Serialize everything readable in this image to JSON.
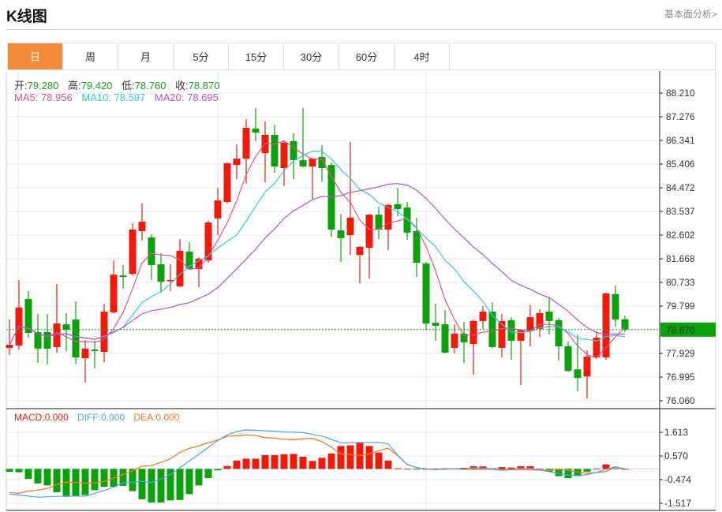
{
  "header": {
    "title": "K线图",
    "link": "基本面分析>"
  },
  "tabs": [
    "日",
    "周",
    "月",
    "5分",
    "15分",
    "30分",
    "60分",
    "4时"
  ],
  "active_tab": 0,
  "ohlc_info": {
    "open_label": "开:",
    "open": "79.280",
    "high_label": "高:",
    "high": "79.420",
    "low_label": "低:",
    "low": "78.760",
    "close_label": "收:",
    "close": "78.870"
  },
  "ma_info": {
    "ma5": "MA5: 78.956",
    "ma10": "MA10: 78.597",
    "ma20": "MA20: 78.695"
  },
  "macd_info": {
    "macd": "MACD:0.000",
    "diff": "DIFF:0.000",
    "dea": "DEA:0.000"
  },
  "colors": {
    "up": "#f01a0a",
    "down": "#0aa10a",
    "ma5": "#ea4f86",
    "ma10": "#33c8dc",
    "ma20": "#b552c9",
    "diff": "#4aa3f0",
    "dea": "#f57a1a",
    "accent": "#f28c3c"
  },
  "chart_data": {
    "type": "candlestick",
    "price_axis": {
      "ticks": [
        "88.210",
        "87.276",
        "86.341",
        "85.406",
        "84.472",
        "83.537",
        "82.602",
        "81.668",
        "80.733",
        "79.799",
        "78.870",
        "77.929",
        "76.995",
        "76.060"
      ],
      "range": [
        76.06,
        88.21
      ],
      "current": "78.870"
    },
    "macd_axis": {
      "ticks": [
        "1.613",
        "0.570",
        "-0.474",
        "-1.517"
      ],
      "range": [
        -1.517,
        1.613
      ]
    },
    "candles": [
      [
        78.15,
        79.27,
        77.87,
        78.27
      ],
      [
        78.24,
        80.83,
        78.08,
        79.74
      ],
      [
        80.08,
        80.39,
        78.55,
        78.74
      ],
      [
        78.77,
        79.49,
        77.55,
        78.12
      ],
      [
        78.77,
        79.49,
        77.49,
        78.12
      ],
      [
        78.18,
        80.67,
        77.96,
        79.11
      ],
      [
        79.08,
        79.52,
        78.02,
        78.86
      ],
      [
        79.27,
        79.99,
        77.52,
        77.77
      ],
      [
        77.74,
        78.46,
        76.78,
        78.12
      ],
      [
        78.08,
        78.43,
        77.33,
        78.02
      ],
      [
        77.99,
        79.89,
        77.58,
        79.58
      ],
      [
        79.55,
        81.6,
        79.5,
        81.04
      ],
      [
        81.01,
        81.42,
        80.49,
        80.95
      ],
      [
        81.07,
        83.07,
        81.01,
        82.82
      ],
      [
        82.76,
        83.85,
        82.39,
        83.13
      ],
      [
        82.51,
        82.64,
        80.83,
        81.42
      ],
      [
        81.45,
        81.89,
        80.33,
        80.76
      ],
      [
        80.8,
        81.45,
        80.39,
        80.83
      ],
      [
        80.58,
        82.45,
        80.55,
        81.98
      ],
      [
        81.95,
        82.32,
        81.23,
        81.26
      ],
      [
        81.26,
        81.73,
        80.55,
        81.67
      ],
      [
        81.6,
        83.19,
        81.51,
        83.1
      ],
      [
        83.26,
        84.47,
        82.6,
        83.97
      ],
      [
        83.91,
        85.47,
        83.85,
        85.44
      ],
      [
        85.37,
        86.18,
        84.81,
        85.62
      ],
      [
        85.62,
        87.18,
        84.63,
        86.84
      ],
      [
        86.81,
        87.62,
        86.31,
        86.65
      ],
      [
        85.84,
        87.09,
        84.69,
        86.56
      ],
      [
        86.56,
        86.96,
        85.06,
        85.31
      ],
      [
        85.25,
        86.31,
        84.54,
        86.25
      ],
      [
        86.31,
        86.62,
        84.81,
        85.56
      ],
      [
        85.56,
        87.62,
        85.28,
        85.31
      ],
      [
        85.31,
        85.65,
        84.03,
        85.62
      ],
      [
        85.69,
        86.15,
        84.72,
        85.25
      ],
      [
        85.37,
        85.47,
        82.54,
        82.82
      ],
      [
        82.79,
        83.44,
        81.54,
        82.48
      ],
      [
        82.6,
        86.28,
        81.82,
        83.29
      ],
      [
        81.82,
        82.17,
        80.7,
        82.14
      ],
      [
        82.1,
        83.44,
        80.89,
        83.41
      ],
      [
        83.41,
        83.72,
        82.45,
        82.82
      ],
      [
        82.82,
        83.85,
        82.01,
        83.79
      ],
      [
        83.82,
        84.47,
        83.35,
        83.63
      ],
      [
        83.69,
        83.91,
        82.42,
        82.7
      ],
      [
        82.76,
        83.29,
        80.95,
        81.51
      ],
      [
        81.48,
        81.54,
        78.86,
        79.11
      ],
      [
        79.14,
        79.89,
        78.43,
        79.02
      ],
      [
        79.08,
        79.64,
        77.93,
        77.96
      ],
      [
        78.15,
        79.08,
        77.93,
        78.71
      ],
      [
        78.71,
        79.17,
        77.55,
        78.37
      ],
      [
        78.3,
        79.27,
        77.08,
        79.21
      ],
      [
        79.21,
        79.8,
        78.89,
        79.58
      ],
      [
        79.58,
        79.95,
        78.15,
        78.18
      ],
      [
        78.15,
        79.49,
        77.77,
        79.21
      ],
      [
        79.24,
        79.36,
        77.68,
        78.43
      ],
      [
        78.43,
        78.89,
        76.68,
        78.86
      ],
      [
        78.83,
        79.83,
        78.21,
        79.36
      ],
      [
        78.89,
        79.67,
        78.58,
        79.52
      ],
      [
        79.58,
        80.14,
        78.68,
        79.21
      ],
      [
        79.24,
        79.33,
        77.65,
        78.21
      ],
      [
        78.21,
        78.4,
        77.2,
        77.24
      ],
      [
        77.3,
        78.68,
        76.43,
        76.96
      ],
      [
        77.02,
        78.05,
        76.15,
        77.8
      ],
      [
        77.77,
        78.8,
        77.71,
        78.55
      ],
      [
        77.77,
        80.33,
        77.68,
        80.3
      ],
      [
        80.27,
        80.61,
        78.99,
        79.27
      ],
      [
        79.28,
        79.42,
        78.76,
        78.87
      ]
    ],
    "macd_hist": [
      -0.13,
      -0.15,
      -0.44,
      -0.64,
      -0.73,
      -1.03,
      -1.23,
      -1.2,
      -1.15,
      -0.94,
      -0.79,
      -0.79,
      -0.75,
      -0.98,
      -1.34,
      -1.48,
      -1.48,
      -1.39,
      -1.37,
      -1.11,
      -0.73,
      -0.41,
      -0.06,
      0.13,
      0.37,
      0.45,
      0.45,
      0.61,
      0.61,
      0.65,
      0.66,
      0.54,
      0.35,
      0.49,
      0.68,
      1.01,
      1.04,
      1.15,
      1.01,
      0.72,
      0.37,
      0.03,
      0.01,
      -0.02,
      0.0,
      0.02,
      0.03,
      0.02,
      0.05,
      0.12,
      0.11,
      0.03,
      0.08,
      0.06,
      0.12,
      0.12,
      0.01,
      -0.12,
      -0.32,
      -0.41,
      -0.32,
      -0.12,
      0.02,
      0.2,
      0.03,
      0.0
    ],
    "diff": [
      -1.11,
      -1.15,
      -1.2,
      -1.25,
      -1.23,
      -1.21,
      -1.2,
      -1.2,
      -1.2,
      -1.08,
      -0.95,
      -0.8,
      -0.62,
      -0.58,
      -0.55,
      -0.6,
      -0.45,
      -0.25,
      0.05,
      0.35,
      0.65,
      0.95,
      1.25,
      1.5,
      1.65,
      1.72,
      1.7,
      1.68,
      1.66,
      1.63,
      1.62,
      1.6,
      1.52,
      1.45,
      1.3,
      1.15,
      1.16,
      1.17,
      1.17,
      1.17,
      1.1,
      0.6,
      0.2,
      0.05,
      0.0,
      -0.02,
      0.0,
      0.01,
      0.0,
      0.05,
      0.04,
      0.0,
      -0.02,
      -0.01,
      0.02,
      0.02,
      -0.05,
      -0.12,
      -0.2,
      -0.27,
      -0.3,
      -0.25,
      -0.15,
      -0.02,
      0.1,
      0.0
    ]
  }
}
